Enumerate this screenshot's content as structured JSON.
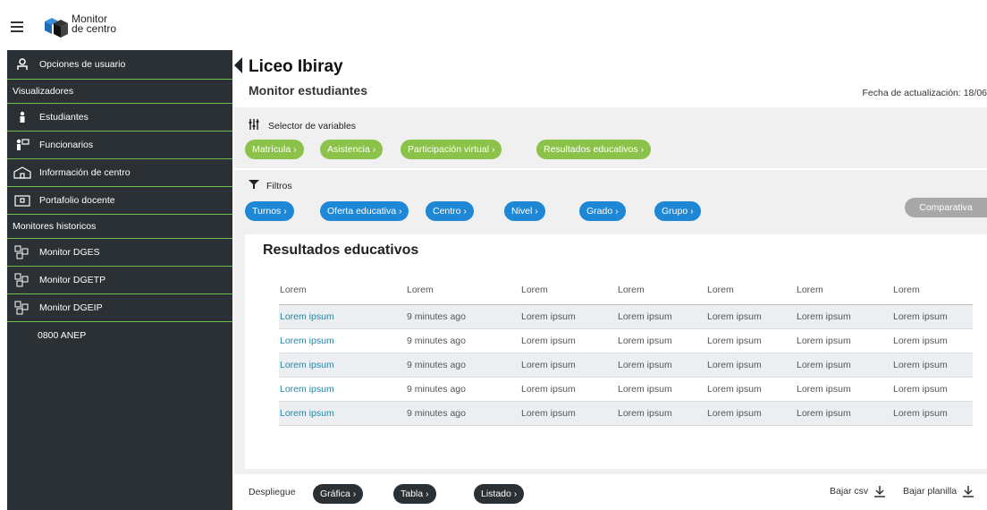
{
  "brand": {
    "line1": "Monitor",
    "line2": "de centro"
  },
  "sidebar": {
    "user_options": "Opciones de usuario",
    "section_viewers": "Visualizadores",
    "viewers": [
      {
        "label": "Estudiantes",
        "icon": "student-icon"
      },
      {
        "label": "Funcionarios",
        "icon": "staff-icon"
      },
      {
        "label": "Información de centro",
        "icon": "school-icon"
      },
      {
        "label": "Portafolio docente",
        "icon": "portfolio-icon"
      }
    ],
    "section_historic": "Monitores historicos",
    "historic": [
      {
        "label": "Monitor DGES",
        "icon": "cubes-icon"
      },
      {
        "label": "Monitor DGETP",
        "icon": "cubes-icon"
      },
      {
        "label": "Monitor DGEIP",
        "icon": "cubes-icon"
      }
    ],
    "phone": "0800 ANEP"
  },
  "header": {
    "title": "Liceo Ibiray",
    "subtitle": "Monitor estudiantes",
    "updated": "Fecha de actualización: 18/06"
  },
  "selector": {
    "label": "Selector de variables",
    "pills": [
      "Matrícula ›",
      "Asistencia ›",
      "Participación virtual ›",
      "Resultados educativos ›"
    ]
  },
  "filters": {
    "label": "Filtros",
    "pills": [
      "Turnos ›",
      "Oferta educativa ›",
      "Centro ›",
      "Nivel ›",
      "Grado ›",
      "Grupo ›"
    ],
    "compare": "Comparativa"
  },
  "results": {
    "title": "Resultados educativos",
    "columns": [
      "Lorem",
      "Lorem",
      "Lorem",
      "Lorem",
      "Lorem",
      "Lorem",
      "Lorem"
    ],
    "rows": [
      [
        "Lorem ipsum",
        "9 minutes ago",
        "Lorem ipsum",
        "Lorem ipsum",
        "Lorem ipsum",
        "Lorem ipsum",
        "Lorem ipsum"
      ],
      [
        "Lorem ipsum",
        "9 minutes ago",
        "Lorem ipsum",
        "Lorem ipsum",
        "Lorem ipsum",
        "Lorem ipsum",
        "Lorem ipsum"
      ],
      [
        "Lorem ipsum",
        "9 minutes ago",
        "Lorem ipsum",
        "Lorem ipsum",
        "Lorem ipsum",
        "Lorem ipsum",
        "Lorem ipsum"
      ],
      [
        "Lorem ipsum",
        "9 minutes ago",
        "Lorem ipsum",
        "Lorem ipsum",
        "Lorem ipsum",
        "Lorem ipsum",
        "Lorem ipsum"
      ],
      [
        "Lorem ipsum",
        "9 minutes ago",
        "Lorem ipsum",
        "Lorem ipsum",
        "Lorem ipsum",
        "Lorem ipsum",
        "Lorem ipsum"
      ]
    ]
  },
  "footer": {
    "label": "Despliegue",
    "views": [
      "Gráfica ›",
      "Tabla ›",
      "Listado ›"
    ],
    "download_csv": "Bajar csv",
    "download_sheet": "Bajar planilla"
  },
  "colors": {
    "sidebar": "#2b3034",
    "accent_green": "#8bc34a",
    "accent_blue": "#1e88d6",
    "link": "#1e88a8"
  }
}
